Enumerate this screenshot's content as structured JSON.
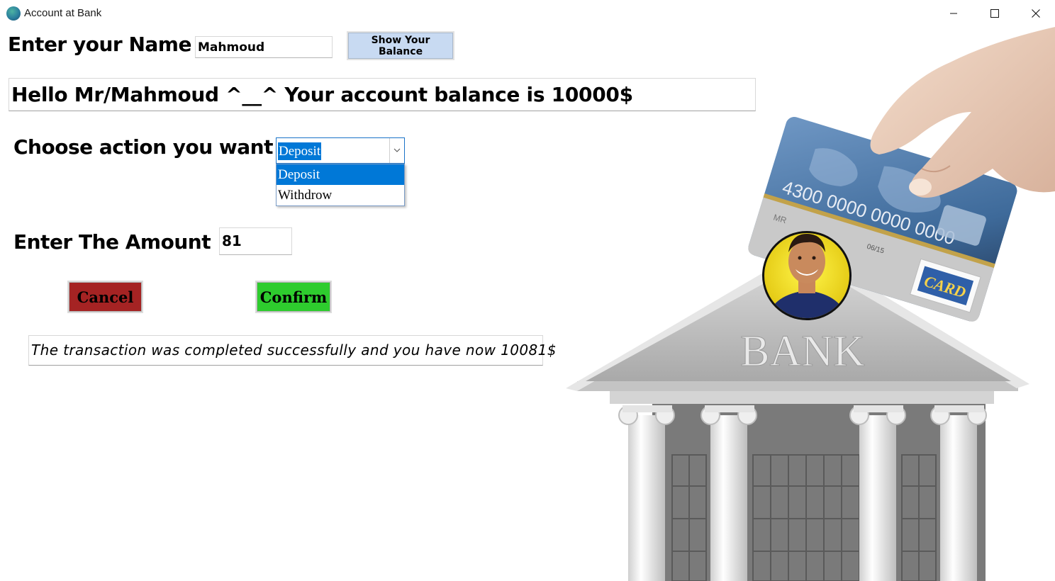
{
  "window": {
    "title": "Account at Bank",
    "controls": {
      "minimize": "minimize-icon",
      "maximize": "maximize-icon",
      "close": "close-icon"
    }
  },
  "form": {
    "name_label": "Enter your Name",
    "name_value": "Mahmoud",
    "show_balance_label": "Show Your Balance",
    "greeting": "Hello Mr/Mahmoud ^__^ Your account balance is 10000$",
    "action_label": "Choose action you want",
    "action_selected": "Deposit",
    "action_options": [
      "Deposit",
      "Withdrow"
    ],
    "amount_label": "Enter The Amount",
    "amount_value": "81",
    "cancel_label": "Cancel",
    "confirm_label": "Confirm",
    "result_message": "The transaction was completed successfully and you have now 10081$"
  },
  "illustration": {
    "bank_sign": "BANK",
    "card_number": "4300 0000 0000 0000",
    "card_holder": "MR",
    "card_expiry": "06/15",
    "card_brand": "CARD"
  },
  "colors": {
    "selection_blue": "#0078d7",
    "show_balance_bg": "#c8daf2",
    "cancel_bg": "#a52323",
    "confirm_bg": "#2ecc2e",
    "bank_gray": "#b8b8b8",
    "avatar_ring": "#f2e21a"
  }
}
